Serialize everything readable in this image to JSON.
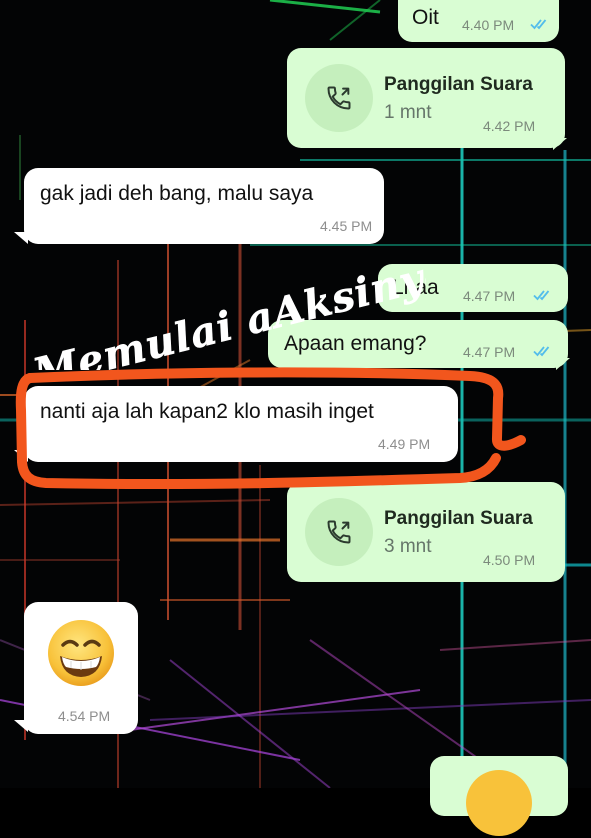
{
  "chat": {
    "messages": [
      {
        "id": "m1",
        "direction": "out",
        "text": "Oit",
        "time": "4.40 PM",
        "read": true
      },
      {
        "id": "m2",
        "direction": "out",
        "type": "voice-call",
        "title": "Panggilan Suara",
        "duration": "1 mnt",
        "time": "4.42 PM"
      },
      {
        "id": "m3",
        "direction": "in",
        "text": "gak jadi deh bang, malu saya",
        "time": "4.45 PM"
      },
      {
        "id": "m4",
        "direction": "out",
        "text": "Lhaa",
        "time": "4.47 PM",
        "read": true
      },
      {
        "id": "m5",
        "direction": "out",
        "text": "Apaan emang?",
        "time": "4.47 PM",
        "read": true
      },
      {
        "id": "m6",
        "direction": "in",
        "text": "nanti aja lah kapan2 klo masih inget",
        "time": "4.49 PM",
        "highlighted": true
      },
      {
        "id": "m7",
        "direction": "out",
        "type": "voice-call",
        "title": "Panggilan Suara",
        "duration": "3 mnt",
        "time": "4.50 PM"
      },
      {
        "id": "m8",
        "direction": "in",
        "type": "emoji",
        "emoji": "grinning-face",
        "time": "4.54 PM"
      }
    ]
  },
  "overlay": {
    "caption": "Memulai aAksinya",
    "caption_color": "#ffffff",
    "highlight_color": "#f2561d"
  },
  "colors": {
    "outgoing_bubble": "#d9fdd3",
    "incoming_bubble": "#ffffff",
    "read_ticks": "#53bdeb",
    "background": "#000000"
  },
  "icons": {
    "call": "outgoing-call-icon",
    "read_receipt": "double-check-icon"
  }
}
